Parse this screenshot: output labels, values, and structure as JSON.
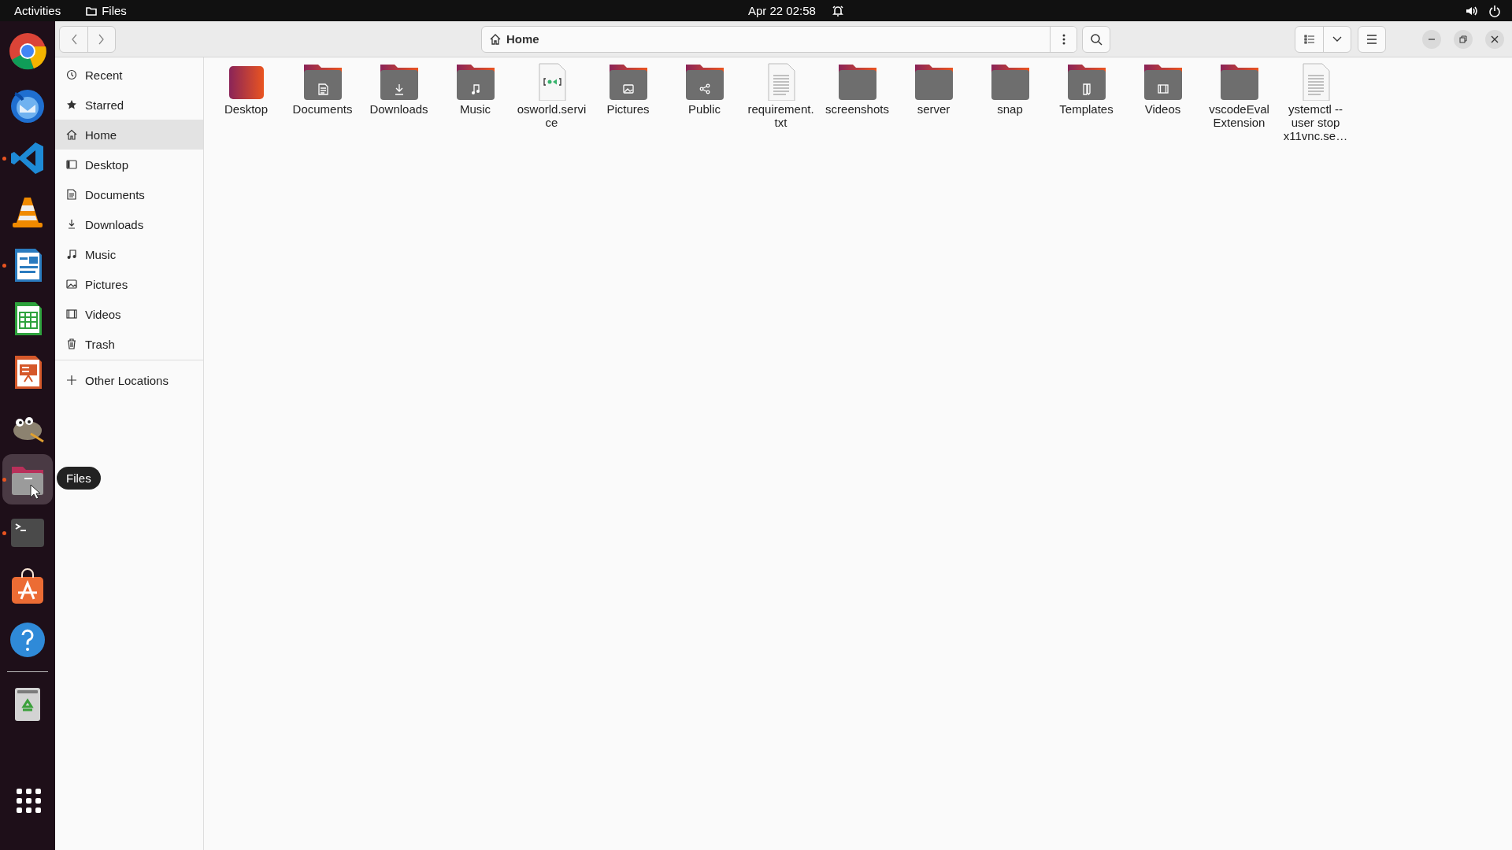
{
  "top_bar": {
    "activities": "Activities",
    "app_menu": "Files",
    "clock": "Apr 22  02:58"
  },
  "dock": {
    "items": [
      {
        "kind": "chrome",
        "running": false,
        "focused": false
      },
      {
        "kind": "mail",
        "running": false,
        "focused": false
      },
      {
        "kind": "code",
        "running": true,
        "focused": false
      },
      {
        "kind": "cone",
        "running": false,
        "focused": false
      },
      {
        "kind": "writer",
        "running": true,
        "focused": false
      },
      {
        "kind": "calc",
        "running": false,
        "focused": false
      },
      {
        "kind": "impress",
        "running": false,
        "focused": false
      },
      {
        "kind": "gimp",
        "running": false,
        "focused": false
      },
      {
        "kind": "files",
        "running": true,
        "focused": true
      },
      {
        "kind": "terminal",
        "running": true,
        "focused": false
      },
      {
        "kind": "store",
        "running": false,
        "focused": false
      },
      {
        "kind": "help",
        "running": false,
        "focused": false
      },
      {
        "kind": "trash",
        "running": false,
        "focused": false
      }
    ],
    "tooltip": "Files"
  },
  "header": {
    "path": "Home"
  },
  "sidebar": {
    "items": [
      {
        "label": "Recent",
        "kind": "recent",
        "selected": false
      },
      {
        "label": "Starred",
        "kind": "starred",
        "selected": false
      },
      {
        "label": "Home",
        "kind": "home",
        "selected": true
      },
      {
        "label": "Desktop",
        "kind": "desktop",
        "selected": false
      },
      {
        "label": "Documents",
        "kind": "documents",
        "selected": false
      },
      {
        "label": "Downloads",
        "kind": "downloads",
        "selected": false
      },
      {
        "label": "Music",
        "kind": "music",
        "selected": false
      },
      {
        "label": "Pictures",
        "kind": "pictures",
        "selected": false
      },
      {
        "label": "Videos",
        "kind": "videos",
        "selected": false
      },
      {
        "label": "Trash",
        "kind": "trash",
        "selected": false
      }
    ],
    "other_locations": "Other Locations"
  },
  "files": [
    {
      "name": "Desktop",
      "kind": "desktop"
    },
    {
      "name": "Documents",
      "kind": "documents"
    },
    {
      "name": "Downloads",
      "kind": "downloads"
    },
    {
      "name": "Music",
      "kind": "music"
    },
    {
      "name": "osworld.service",
      "kind": "service"
    },
    {
      "name": "Pictures",
      "kind": "pictures"
    },
    {
      "name": "Public",
      "kind": "public"
    },
    {
      "name": "requirement.txt",
      "kind": "text"
    },
    {
      "name": "screenshots",
      "kind": "folder"
    },
    {
      "name": "server",
      "kind": "folder"
    },
    {
      "name": "snap",
      "kind": "folder"
    },
    {
      "name": "Templates",
      "kind": "templates"
    },
    {
      "name": "Videos",
      "kind": "videos"
    },
    {
      "name": "vscodeEval Extension",
      "kind": "folder"
    },
    {
      "name": "ystemctl --user stop x11vnc.se…",
      "kind": "text"
    }
  ]
}
